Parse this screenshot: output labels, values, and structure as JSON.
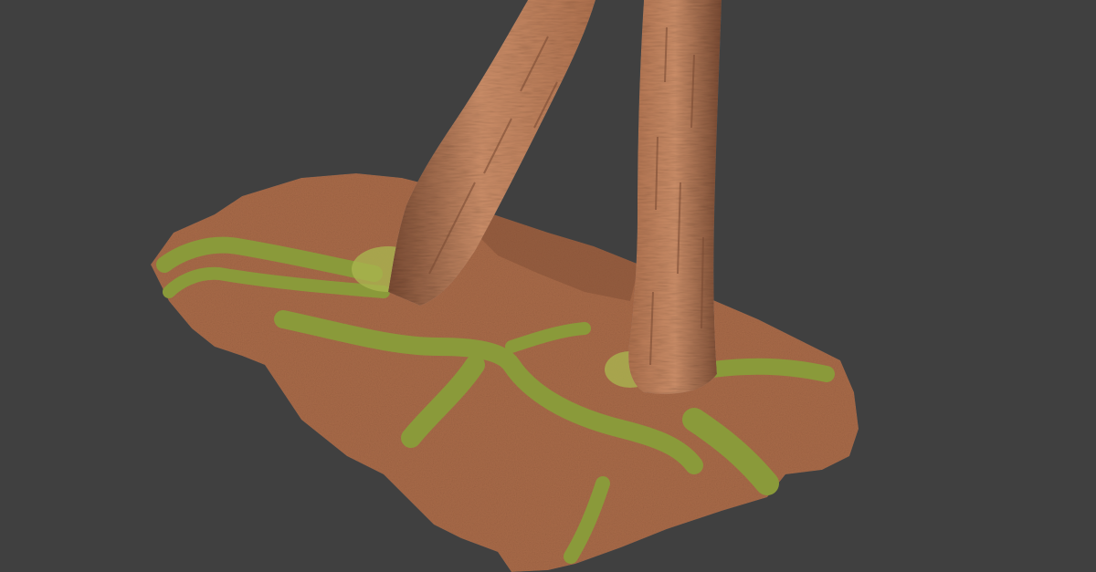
{
  "scene": {
    "background_color": "#404040",
    "subject": "photogrammetry-scan",
    "objects": [
      {
        "name": "ground-patch",
        "kind": "terrain",
        "covering": "leaf-litter"
      },
      {
        "name": "leaning-tree-trunk",
        "kind": "trunk",
        "orientation": "leaning-right"
      },
      {
        "name": "upright-tree-trunk",
        "kind": "trunk",
        "orientation": "vertical"
      },
      {
        "name": "mossy-root",
        "kind": "root",
        "count": 5
      }
    ],
    "colors": {
      "ground": "#a86a48",
      "ground_shadow": "#7d4c33",
      "bark": "#b0724f",
      "bark_dark": "#7a4b33",
      "bark_light": "#cd8f69",
      "moss": "#8a9a3a",
      "moss_light": "#a9b44f"
    }
  }
}
